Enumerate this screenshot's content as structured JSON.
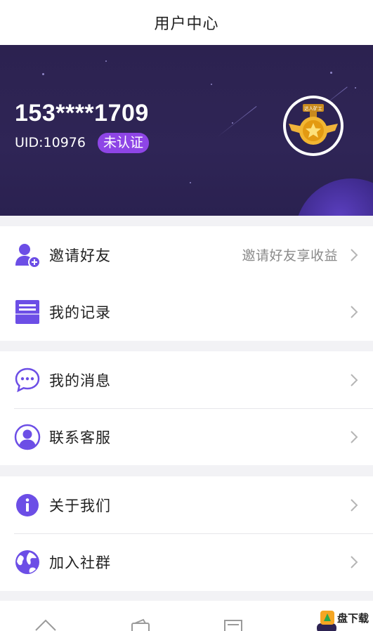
{
  "header": {
    "title": "用户中心"
  },
  "profile": {
    "phone": "153****1709",
    "uid": "UID:10976",
    "verify_badge": "未认证",
    "medal_label": "达人矿工"
  },
  "menu_groups": [
    {
      "items": [
        {
          "label": "邀请好友",
          "hint": "邀请好友享收益",
          "icon": "add-friend-icon"
        },
        {
          "label": "我的记录",
          "hint": "",
          "icon": "record-icon"
        }
      ]
    },
    {
      "items": [
        {
          "label": "我的消息",
          "hint": "",
          "icon": "message-icon"
        },
        {
          "label": "联系客服",
          "hint": "",
          "icon": "customer-service-icon"
        }
      ]
    },
    {
      "items": [
        {
          "label": "关于我们",
          "hint": "",
          "icon": "info-icon"
        },
        {
          "label": "加入社群",
          "hint": "",
          "icon": "globe-icon"
        }
      ]
    }
  ],
  "tabbar": {
    "icons": [
      "home-icon",
      "wallet-icon",
      "list-icon",
      "user-icon"
    ]
  },
  "watermark": {
    "text": "盘下载"
  },
  "colors": {
    "accent": "#6c4ee6",
    "badge": "#8e45e6",
    "hero_bg": "#2d2352"
  }
}
